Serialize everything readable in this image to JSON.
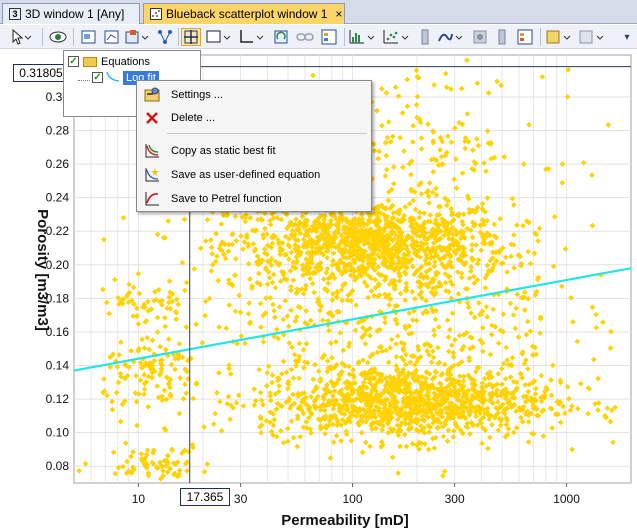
{
  "tabs": [
    {
      "label": "3D window 1 [Any]",
      "icon": "3"
    },
    {
      "label": "Blueback scatterplot window 1",
      "close": "×"
    }
  ],
  "toolbar": {
    "overflow_glyph": "▾"
  },
  "legend": {
    "root_label": "Equations",
    "item_label": "Log fit",
    "root_checked": "✓",
    "item_checked": "✓"
  },
  "context_menu": {
    "items": [
      {
        "label": "Settings ...",
        "icon": "settings-icon"
      },
      {
        "label": "Delete ...",
        "icon": "delete-icon"
      },
      {
        "label": "Copy as static best fit",
        "icon": "copy-fit-icon"
      },
      {
        "label": "Save as user-defined equation",
        "icon": "save-equation-icon"
      },
      {
        "label": "Save to Petrel function",
        "icon": "petrel-function-icon"
      }
    ]
  },
  "cursor_readout": {
    "x_value": "17.365",
    "y_value": "0.31805"
  },
  "chart_data": {
    "type": "scatter",
    "xlabel": "Permeability [mD]",
    "ylabel": "Porosity [m3/m3]",
    "x_scale": "log",
    "xlim": [
      5,
      2000
    ],
    "ylim": [
      0.07,
      0.325
    ],
    "x_ticks": [
      "10",
      "30",
      "100",
      "300",
      "1000"
    ],
    "x_tick_values": [
      10,
      30,
      100,
      300,
      1000
    ],
    "y_ticks": [
      "0.08",
      "0.10",
      "0.12",
      "0.14",
      "0.16",
      "0.18",
      "0.20",
      "0.22",
      "0.24",
      "0.26",
      "0.28",
      "0.30"
    ],
    "y_tick_values": [
      0.08,
      0.1,
      0.12,
      0.14,
      0.16,
      0.18,
      0.2,
      0.22,
      0.24,
      0.26,
      0.28,
      0.3
    ],
    "grid": true,
    "point_color": "#ffd200",
    "fit_line": {
      "name": "Log fit",
      "color": "#22e5ea",
      "x": [
        5,
        2000
      ],
      "y": [
        0.137,
        0.198
      ]
    },
    "cursor": {
      "x": 17.365,
      "y": 0.31805
    },
    "clusters": [
      {
        "cx": 120,
        "cy": 0.213,
        "sx_log": 0.33,
        "sy": 0.013,
        "n": 1150
      },
      {
        "cx": 180,
        "cy": 0.118,
        "sx_log": 0.34,
        "sy": 0.011,
        "n": 1100
      },
      {
        "cx": 150,
        "cy": 0.168,
        "sx_log": 0.4,
        "sy": 0.03,
        "n": 520
      },
      {
        "cx": 12,
        "cy": 0.135,
        "sx_log": 0.12,
        "sy": 0.012,
        "n": 120
      },
      {
        "cx": 11,
        "cy": 0.175,
        "sx_log": 0.12,
        "sy": 0.008,
        "n": 50
      },
      {
        "cx": 12,
        "cy": 0.083,
        "sx_log": 0.13,
        "sy": 0.005,
        "n": 70
      },
      {
        "cx": 200,
        "cy": 0.27,
        "sx_log": 0.3,
        "sy": 0.022,
        "n": 170
      }
    ]
  }
}
